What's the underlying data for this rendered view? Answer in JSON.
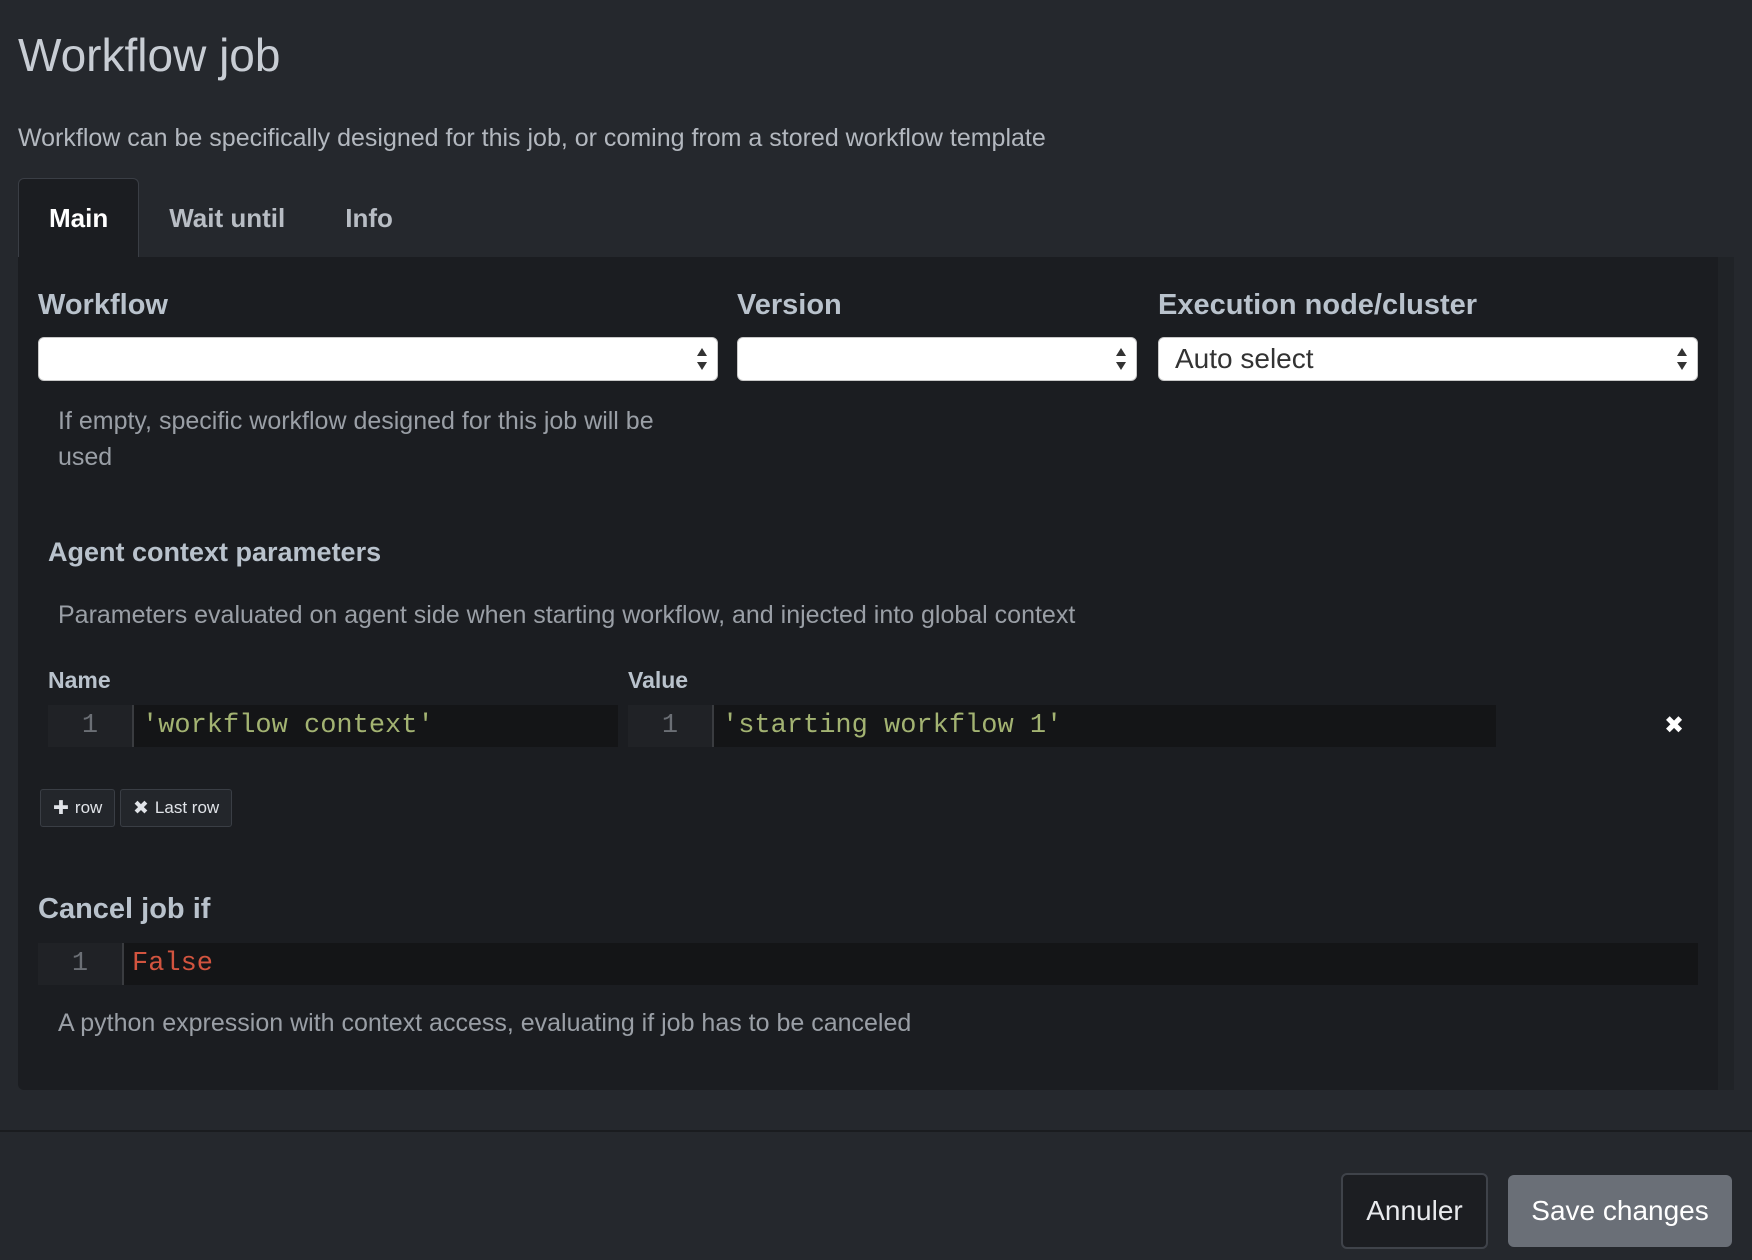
{
  "header": {
    "title": "Workflow job",
    "subtitle": "Workflow can be specifically designed for this job, or coming from a stored workflow template"
  },
  "tabs": [
    {
      "label": "Main",
      "active": true
    },
    {
      "label": "Wait until",
      "active": false
    },
    {
      "label": "Info",
      "active": false
    }
  ],
  "main": {
    "workflow": {
      "label": "Workflow",
      "value": "",
      "help": "If empty, specific workflow designed for this job will be used"
    },
    "version": {
      "label": "Version",
      "value": ""
    },
    "execution": {
      "label": "Execution node/cluster",
      "value": "Auto select"
    },
    "agent_context": {
      "title": "Agent context parameters",
      "description": "Parameters evaluated on agent side when starting workflow, and injected into global context",
      "columns": {
        "name": "Name",
        "value": "Value"
      },
      "rows": [
        {
          "name_line": "1",
          "name": "'workflow context'",
          "value_line": "1",
          "value": "'starting workflow 1'"
        }
      ],
      "add_row_label": "row",
      "remove_last_label": "Last row"
    },
    "cancel": {
      "title": "Cancel job if",
      "line": "1",
      "expression": "False",
      "help": "A python expression with context access, evaluating if job has to be canceled"
    }
  },
  "footer": {
    "cancel_label": "Annuler",
    "save_label": "Save changes"
  },
  "colors": {
    "background": "#25282d",
    "panel": "#1b1d21",
    "string_token": "#a3b372",
    "keyword_token": "#d2543f",
    "primary_button": "#6a6f77"
  }
}
